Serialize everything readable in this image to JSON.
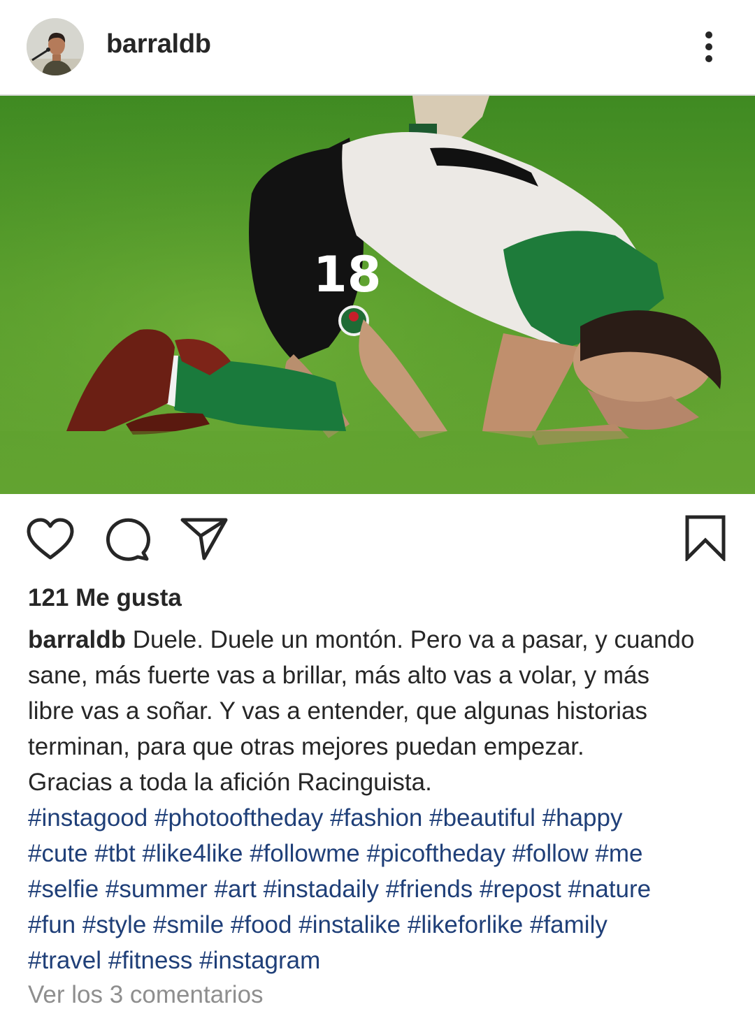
{
  "post": {
    "username": "barraldb",
    "likes_text": "121 Me gusta",
    "caption_lines": [
      "Duele. Duele un montón. Pero va a pasar, y cuando",
      "sane, más fuerte vas a brillar, más alto vas a volar, y más",
      "libre vas a soñar. Y vas a entender, que algunas historias",
      "terminan, para que otras mejores puedan empezar.",
      "Gracias a toda la afición Racinguista."
    ],
    "hashtag_lines": [
      [
        "#instagood",
        "#photooftheday",
        "#fashion",
        "#beautiful",
        "#happy"
      ],
      [
        "#cute",
        "#tbt",
        "#like4like",
        "#followme",
        "#picoftheday",
        "#follow",
        "#me"
      ],
      [
        "#selfie",
        "#summer",
        "#art",
        "#instadaily",
        "#friends",
        "#repost",
        "#nature"
      ],
      [
        "#fun",
        "#style",
        "#smile",
        "#food",
        "#instalike",
        "#likeforlike",
        "#family"
      ],
      [
        "#travel",
        "#fitness",
        "#instagram"
      ]
    ],
    "view_comments": "Ver los 3 comentarios",
    "jersey_number": "18"
  },
  "icons": {
    "more": "more-vertical-icon",
    "like": "heart-icon",
    "comment": "comment-icon",
    "share": "send-icon",
    "save": "bookmark-icon"
  },
  "colors": {
    "hashtag": "#1f3f78",
    "text": "#262626",
    "muted": "#8e8e8e",
    "divider": "#dbdbdb"
  }
}
